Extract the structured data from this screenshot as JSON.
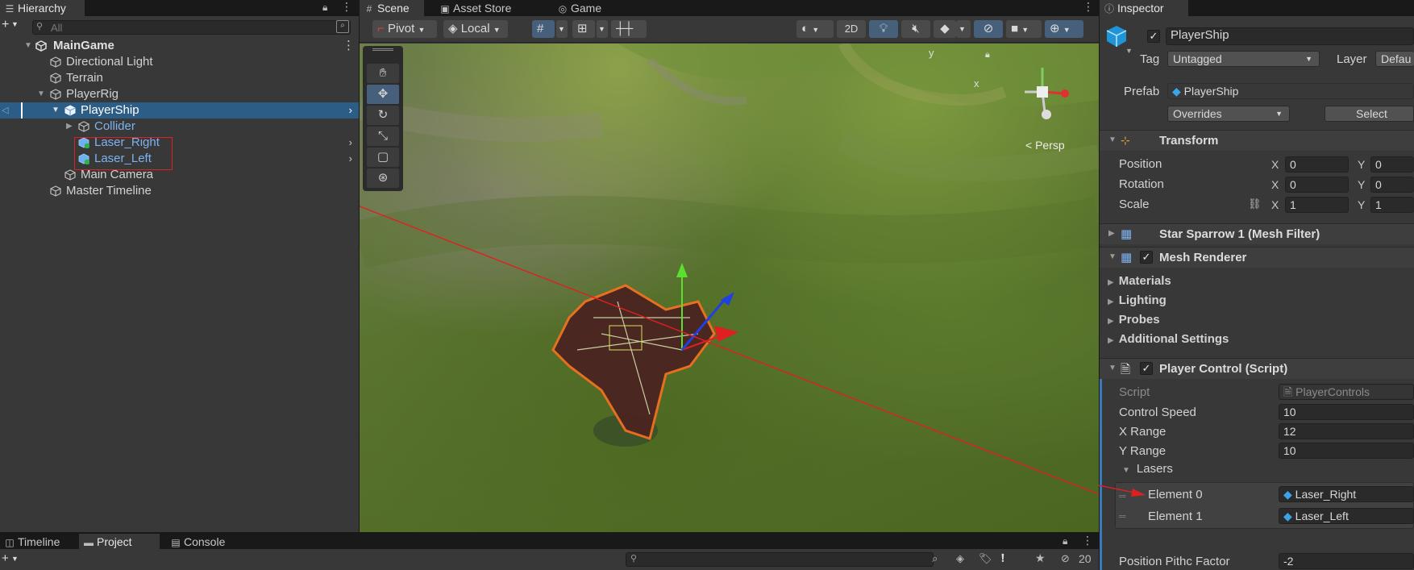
{
  "hierarchy": {
    "tab_label": "Hierarchy",
    "search_placeholder": "All",
    "items": {
      "maingame": "MainGame",
      "directional_light": "Directional Light",
      "terrain": "Terrain",
      "playerrig": "PlayerRig",
      "playership": "PlayerShip",
      "collider": "Collider",
      "laser_right": "Laser_Right",
      "laser_left": "Laser_Left",
      "main_camera": "Main Camera",
      "master_timeline": "Master Timeline"
    }
  },
  "scene": {
    "tabs": {
      "scene": "Scene",
      "asset_store": "Asset Store",
      "game": "Game"
    },
    "toolbar": {
      "pivot": "Pivot",
      "local": "Local",
      "mode_2d": "2D"
    },
    "gizmo": {
      "y": "y",
      "x": "x",
      "persp": "Persp"
    }
  },
  "inspector": {
    "tab_label": "Inspector",
    "object_name": "PlayerShip",
    "tag_label": "Tag",
    "tag_value": "Untagged",
    "layer_label": "Layer",
    "layer_value": "Defau",
    "prefab_label": "Prefab",
    "prefab_value": "PlayerShip",
    "overrides_label": "Overrides",
    "select_label": "Select",
    "transform": {
      "title": "Transform",
      "position_label": "Position",
      "rotation_label": "Rotation",
      "scale_label": "Scale",
      "x": "X",
      "y": "Y",
      "position_x": "0",
      "position_y": "0",
      "rotation_x": "0",
      "rotation_y": "0",
      "scale_x": "1",
      "scale_y": "1"
    },
    "mesh_filter_title": "Star Sparrow 1 (Mesh Filter)",
    "mesh_renderer": {
      "title": "Mesh Renderer",
      "materials": "Materials",
      "lighting": "Lighting",
      "probes": "Probes",
      "additional": "Additional Settings"
    },
    "player_control": {
      "title": "Player Control (Script)",
      "script_label": "Script",
      "script_value": "PlayerControls",
      "control_speed_label": "Control Speed",
      "control_speed_value": "10",
      "x_range_label": "X Range",
      "x_range_value": "12",
      "y_range_label": "Y Range",
      "y_range_value": "10",
      "lasers_label": "Lasers",
      "element0_label": "Element 0",
      "element0_value": "Laser_Right",
      "element1_label": "Element 1",
      "element1_value": "Laser_Left",
      "pitch_label": "Position Pithc Factor",
      "pitch_value": "-2"
    }
  },
  "bottom": {
    "tabs": {
      "timeline": "Timeline",
      "project": "Project",
      "console": "Console"
    },
    "hidden_count": "20"
  },
  "colors": {
    "selection": "#2c5d87",
    "annotation": "#e02020",
    "accent": "#3a79bb"
  }
}
